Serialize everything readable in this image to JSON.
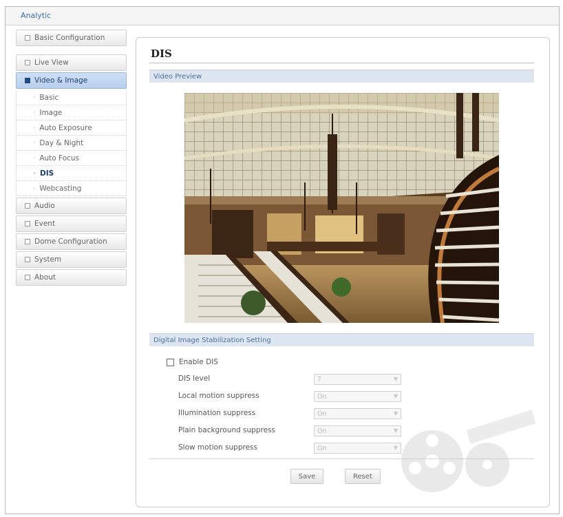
{
  "app": {
    "title": "Analytic"
  },
  "sidebar": {
    "basic_config": "Basic Configuration",
    "live_view": "Live View",
    "video_image": "Video & Image",
    "video_sub": [
      "Basic",
      "Image",
      "Auto Exposure",
      "Day & Night",
      "Auto Focus",
      "DIS",
      "Webcasting"
    ],
    "audio": "Audio",
    "event": "Event",
    "dome_config": "Dome Configuration",
    "system": "System",
    "about": "About"
  },
  "main": {
    "title": "DIS",
    "preview_header": "Video Preview",
    "setting_header": "Digital Image Stabilization Setting",
    "enable_label": "Enable DIS",
    "enable_checked": false,
    "fields": [
      {
        "label": "DIS level",
        "value": "7"
      },
      {
        "label": "Local motion suppress",
        "value": "On"
      },
      {
        "label": "Illumination suppress",
        "value": "On"
      },
      {
        "label": "Plain background suppress",
        "value": "On"
      },
      {
        "label": "Slow motion suppress",
        "value": "On"
      }
    ],
    "save_label": "Save",
    "reset_label": "Reset"
  },
  "colors": {
    "accent": "#1f4a86",
    "section_bg": "#dde5f1"
  }
}
